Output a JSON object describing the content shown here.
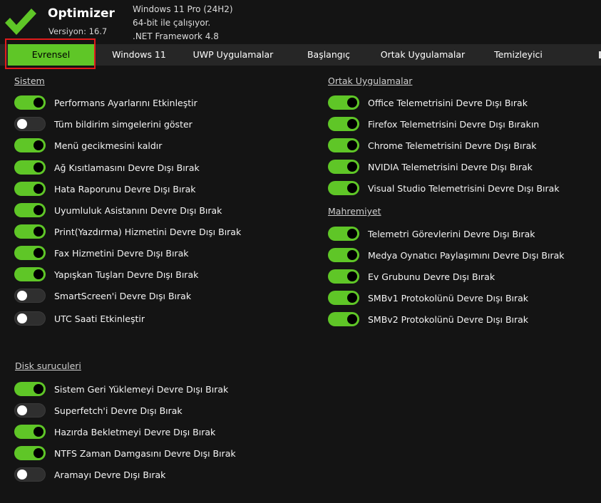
{
  "app": {
    "title": "Optimizer",
    "version": "Versiyon: 16.7",
    "sysinfo": [
      "Windows 11 Pro (24H2)",
      "64-bit ile çalışıyor.",
      ".NET Framework 4.8"
    ],
    "logo_icon": "checkmark-icon",
    "accent": "#5fc627",
    "highlight_color": "#e11b1b"
  },
  "tabs": [
    {
      "label": "Evrensel",
      "active": true
    },
    {
      "label": "Windows 11",
      "active": false
    },
    {
      "label": "UWP Uygulamalar",
      "active": false
    },
    {
      "label": "Başlangıç",
      "active": false
    },
    {
      "label": "Ortak Uygulamalar",
      "active": false
    },
    {
      "label": "Temizleyici",
      "active": false
    }
  ],
  "sections": {
    "sistem": {
      "title": "Sistem",
      "items": [
        {
          "label": "Performans Ayarlarını Etkinleştir",
          "on": true
        },
        {
          "label": "Tüm bildirim simgelerini göster",
          "on": false
        },
        {
          "label": "Menü gecikmesini kaldır",
          "on": true
        },
        {
          "label": "Ağ Kısıtlamasını Devre Dışı Bırak",
          "on": true
        },
        {
          "label": "Hata Raporunu Devre Dışı Bırak",
          "on": true
        },
        {
          "label": "Uyumluluk Asistanını Devre Dışı Bırak",
          "on": true
        },
        {
          "label": "Print(Yazdırma) Hizmetini Devre Dışı Bırak",
          "on": true
        },
        {
          "label": "Fax Hizmetini Devre Dışı Bırak",
          "on": true
        },
        {
          "label": "Yapışkan Tuşları Devre Dışı Bırak",
          "on": true
        },
        {
          "label": "SmartScreen'i Devre Dışı Bırak",
          "on": false
        },
        {
          "label": "UTC Saati Etkinleştir",
          "on": false
        }
      ]
    },
    "disk": {
      "title": "Disk suruculeri",
      "items": [
        {
          "label": "Sistem Geri Yüklemeyi Devre Dışı Bırak",
          "on": true
        },
        {
          "label": "Superfetch'i Devre Dışı Bırak",
          "on": false
        },
        {
          "label": "Hazırda Bekletmeyi Devre Dışı Bırak",
          "on": true
        },
        {
          "label": "NTFS Zaman Damgasını Devre Dışı Bırak",
          "on": true
        },
        {
          "label": "Aramayı Devre Dışı Bırak",
          "on": false
        }
      ]
    },
    "ortak": {
      "title": "Ortak Uygulamalar",
      "items": [
        {
          "label": "Office Telemetrisini Devre Dışı Bırak",
          "on": true
        },
        {
          "label": "Firefox Telemetrisini Devre Dışı Bırakın",
          "on": true
        },
        {
          "label": "Chrome Telemetrisini Devre Dışı Bırak",
          "on": true
        },
        {
          "label": "NVIDIA Telemetrisini Devre Dışı Bırak",
          "on": true
        },
        {
          "label": "Visual Studio Telemetrisini Devre Dışı Bırak",
          "on": true
        }
      ]
    },
    "mahremiyet": {
      "title": "Mahremiyet",
      "items": [
        {
          "label": "Telemetri Görevlerini Devre Dışı Bırak",
          "on": true
        },
        {
          "label": "Medya Oynatıcı Paylaşımını Devre Dışı Bırak",
          "on": true
        },
        {
          "label": "Ev Grubunu Devre Dışı Bırak",
          "on": true
        },
        {
          "label": "SMBv1 Protokolünü Devre Dışı Bırak",
          "on": true
        },
        {
          "label": "SMBv2 Protokolünü Devre Dışı Bırak",
          "on": true
        }
      ]
    }
  }
}
